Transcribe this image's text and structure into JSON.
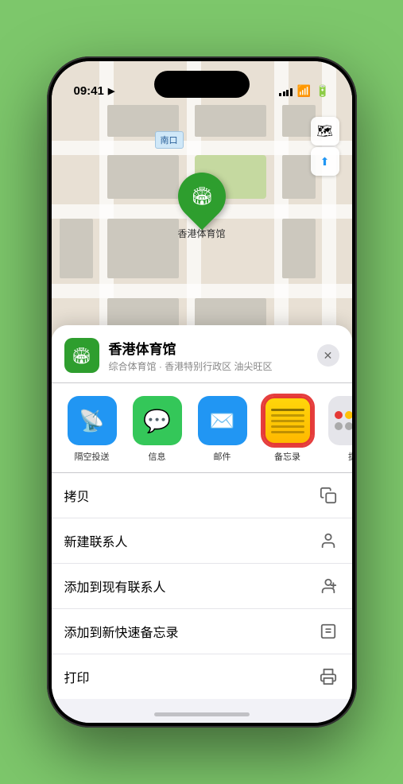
{
  "status": {
    "time": "09:41",
    "location_arrow": "▶"
  },
  "map": {
    "label": "南口",
    "pin_label": "香港体育馆"
  },
  "map_controls": {
    "layers_icon": "🗺",
    "location_icon": "⬆"
  },
  "location_card": {
    "name": "香港体育馆",
    "detail": "综合体育馆 · 香港特别行政区 油尖旺区",
    "close_label": "✕"
  },
  "share_items": [
    {
      "id": "airdrop",
      "label": "隔空投送"
    },
    {
      "id": "messages",
      "label": "信息"
    },
    {
      "id": "mail",
      "label": "邮件"
    },
    {
      "id": "notes",
      "label": "备忘录"
    },
    {
      "id": "more",
      "label": "提"
    }
  ],
  "actions": [
    {
      "label": "拷贝",
      "icon": "copy"
    },
    {
      "label": "新建联系人",
      "icon": "person"
    },
    {
      "label": "添加到现有联系人",
      "icon": "person-add"
    },
    {
      "label": "添加到新快速备忘录",
      "icon": "memo"
    },
    {
      "label": "打印",
      "icon": "print"
    }
  ]
}
